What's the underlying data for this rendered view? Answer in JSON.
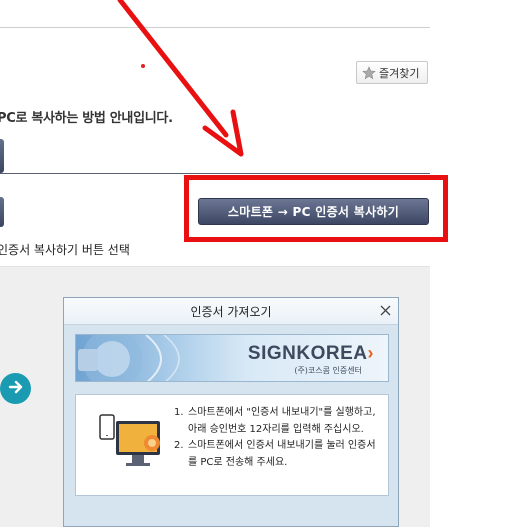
{
  "bookmark": {
    "label": "즐겨찾기",
    "icon": "star-icon"
  },
  "intro": {
    "text": "PC로 복사하는 방법 안내입니다."
  },
  "copy_button": {
    "label": "스마트폰 → PC 인증서 복사하기"
  },
  "step": {
    "text": "인증서 복사하기 버튼 선택"
  },
  "dialog": {
    "title": "인증서 가져오기",
    "close_icon": "close-icon",
    "brand_name": "SIGNKOREA",
    "brand_sub": "(주)코스콤 인증센터",
    "instructions": [
      {
        "num": "1.",
        "text": "스마트폰에서 \"인증서 내보내기\"를 실행하고, 아래 승인번호 12자리를 입력해 주십시오."
      },
      {
        "num": "2.",
        "text": "스마트폰에서 인증서 내보내기를 눌러 인증서를 PC로 전송해 주세요."
      }
    ]
  },
  "colors": {
    "annotation_red": "#e81010",
    "button_navy": "#3d4764",
    "nav_teal": "#1a9bb2"
  }
}
